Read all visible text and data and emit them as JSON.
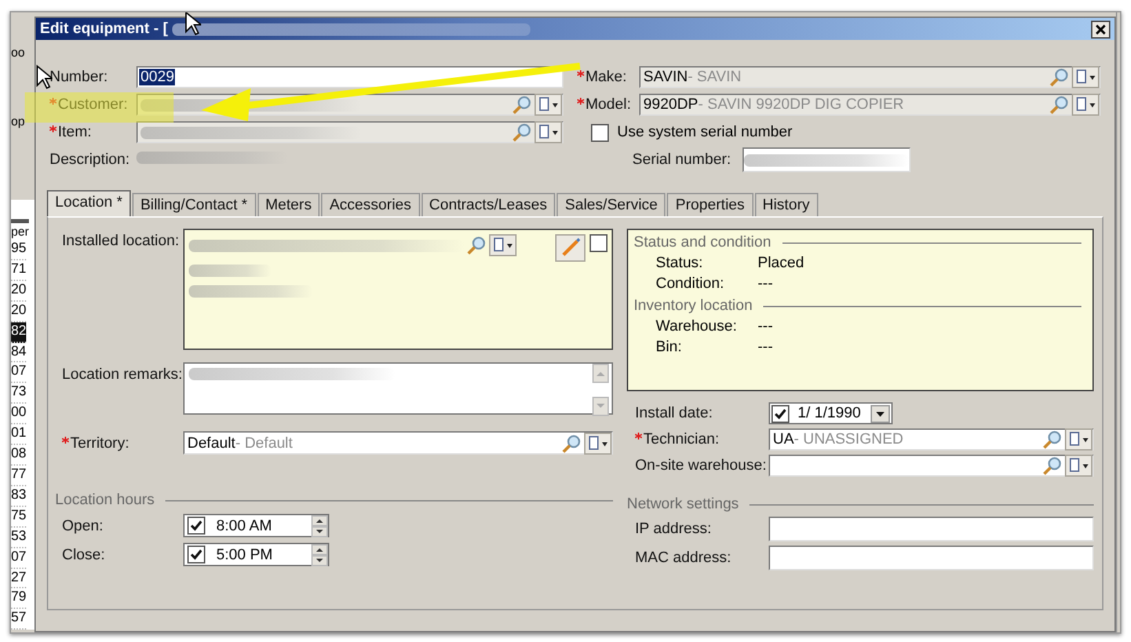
{
  "background_app": {
    "toolbar_fragments": [
      "oo",
      "op"
    ],
    "column_header": "per",
    "column_cells": [
      {
        "text": "95",
        "selected": false
      },
      {
        "text": "71",
        "selected": false
      },
      {
        "text": "20",
        "selected": false
      },
      {
        "text": "20",
        "selected": false
      },
      {
        "text": "82",
        "selected": true
      },
      {
        "text": "84",
        "selected": false
      },
      {
        "text": "07",
        "selected": false
      },
      {
        "text": "73",
        "selected": false
      },
      {
        "text": "00",
        "selected": false
      },
      {
        "text": "01",
        "selected": false
      },
      {
        "text": "08",
        "selected": false
      },
      {
        "text": "77",
        "selected": false
      },
      {
        "text": "83",
        "selected": false
      },
      {
        "text": "75",
        "selected": false
      },
      {
        "text": "53",
        "selected": false
      },
      {
        "text": "07",
        "selected": false
      },
      {
        "text": "27",
        "selected": false
      },
      {
        "text": "79",
        "selected": false
      },
      {
        "text": "57",
        "selected": false
      }
    ]
  },
  "window": {
    "title": "Edit equipment - ["
  },
  "header_left": [
    {
      "kind": "text",
      "label": "Number:",
      "required": false,
      "value": "0029",
      "value_selected": true
    },
    {
      "kind": "lookup",
      "label": "Customer:",
      "required": true,
      "disabled": true,
      "redacted": true
    },
    {
      "kind": "lookup",
      "label": "Item:",
      "required": true,
      "disabled": true,
      "redacted": true
    },
    {
      "kind": "readonly",
      "label": "Description:",
      "required": false,
      "redacted": true
    }
  ],
  "header_right": [
    {
      "kind": "lookup",
      "label": "Make:",
      "required": true,
      "disabled": true,
      "value": "SAVIN",
      "description": "- SAVIN"
    },
    {
      "kind": "lookup",
      "label": "Model:",
      "required": true,
      "disabled": true,
      "value": "9920DP",
      "description": "- SAVIN 9920DP DIG COPIER"
    },
    {
      "kind": "checkbox",
      "label": "Use system serial number",
      "checked": false
    },
    {
      "kind": "text",
      "label": "Serial number:",
      "required": false,
      "redacted": true
    }
  ],
  "tabs": [
    {
      "label": "Location *",
      "selected": true
    },
    {
      "label": "Billing/Contact *",
      "selected": false
    },
    {
      "label": "Meters",
      "selected": false
    },
    {
      "label": "Accessories",
      "selected": false
    },
    {
      "label": "Contracts/Leases",
      "selected": false
    },
    {
      "label": "Sales/Service",
      "selected": false
    },
    {
      "label": "Properties",
      "selected": false
    },
    {
      "label": "History",
      "selected": false
    }
  ],
  "location_tab": {
    "installed_location": {
      "label": "Installed location:",
      "redacted": true,
      "checked": false
    },
    "location_remarks": {
      "label": "Location remarks:",
      "redacted": true
    },
    "territory": {
      "label": "Territory:",
      "required": true,
      "disabled": false,
      "value": "Default",
      "description": "- Default"
    },
    "location_hours": {
      "title": "Location hours",
      "rows": [
        {
          "label": "Open:",
          "checked": true,
          "value": "8:00 AM"
        },
        {
          "label": "Close:",
          "checked": true,
          "value": "5:00 PM"
        }
      ]
    },
    "status_panel": [
      {
        "title": "Status and condition",
        "rows": [
          {
            "label": "Status:",
            "value": "Placed"
          },
          {
            "label": "Condition:",
            "value": "---"
          }
        ]
      },
      {
        "title": "Inventory location",
        "rows": [
          {
            "label": "Warehouse:",
            "value": "---"
          },
          {
            "label": "Bin:",
            "value": "---"
          }
        ]
      }
    ],
    "install_date": {
      "label": "Install date:",
      "checked": true,
      "value": "1/ 1/1990"
    },
    "technician": {
      "label": "Technician:",
      "required": true,
      "disabled": false,
      "value": "UA",
      "description": "- UNASSIGNED"
    },
    "onsite_warehouse": {
      "label": "On-site warehouse:",
      "required": false,
      "disabled": false
    },
    "network_settings": {
      "title": "Network settings",
      "rows": [
        {
          "label": "IP address:"
        },
        {
          "label": "MAC address:"
        }
      ]
    }
  }
}
